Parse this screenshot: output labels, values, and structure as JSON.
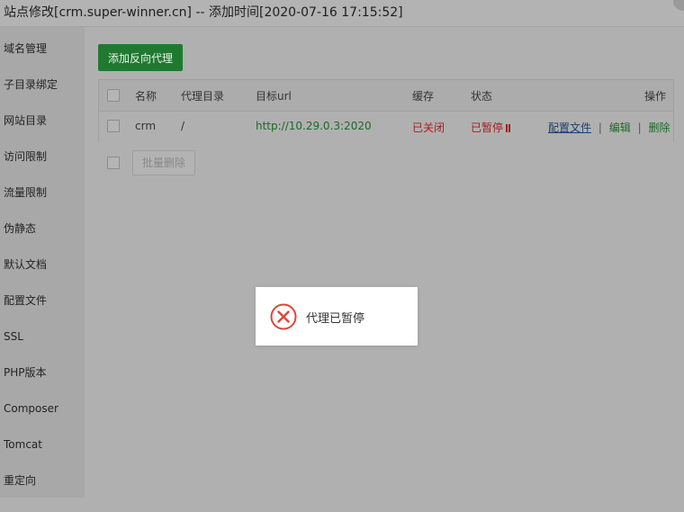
{
  "window": {
    "title": "站点修改[crm.super-winner.cn] -- 添加时间[2020-07-16 17:15:52]"
  },
  "sidebar": {
    "items": [
      {
        "label": "域名管理"
      },
      {
        "label": "子目录绑定"
      },
      {
        "label": "网站目录"
      },
      {
        "label": "访问限制"
      },
      {
        "label": "流量限制"
      },
      {
        "label": "伪静态"
      },
      {
        "label": "默认文档"
      },
      {
        "label": "配置文件"
      },
      {
        "label": "SSL"
      },
      {
        "label": "PHP版本"
      },
      {
        "label": "Composer"
      },
      {
        "label": "Tomcat"
      },
      {
        "label": "重定向"
      }
    ]
  },
  "toolbar": {
    "add_proxy_label": "添加反向代理"
  },
  "table": {
    "headers": {
      "name": "名称",
      "proxy_dir": "代理目录",
      "target_url": "目标url",
      "cache": "缓存",
      "status": "状态",
      "actions": "操作"
    },
    "rows": [
      {
        "name": "crm",
        "proxy_dir": "/",
        "target_url": "http://10.29.0.3:2020",
        "cache": "已关闭",
        "status": "已暂停",
        "actions": {
          "config": "配置文件",
          "edit": "编辑",
          "delete": "删除",
          "separator": "|"
        }
      }
    ]
  },
  "batch_delete_label": "批量删除",
  "toast": {
    "message": "代理已暂停",
    "icon": "error-circle-icon",
    "icon_color": "#e0443a"
  },
  "colors": {
    "accent_green": "#1f7a30",
    "status_red": "#a31e1e",
    "link_blue": "#1d3f6e"
  }
}
